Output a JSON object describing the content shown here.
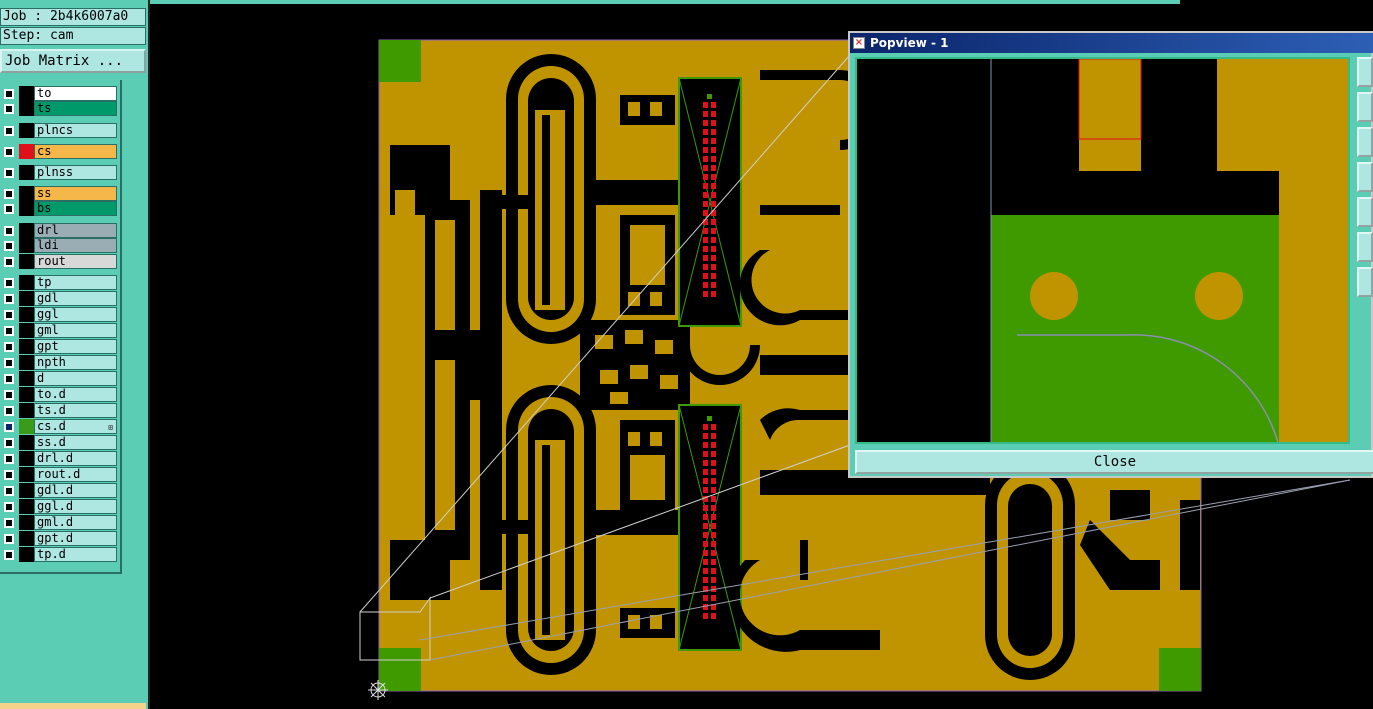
{
  "info": {
    "job": "Job : 2b4k6007a0",
    "step": "Step: cam",
    "job_matrix_label": "Job Matrix ..."
  },
  "layers": [
    {
      "name": "to",
      "bg": "#ffffff",
      "color": "#000000"
    },
    {
      "name": "ts",
      "bg": "#009a6a",
      "color": "#000000"
    },
    {
      "name": "plncs",
      "bg": "#aee6e2",
      "color": "#000000"
    },
    {
      "name": "cs",
      "bg": "#f5b64a",
      "color": "#e0101a"
    },
    {
      "name": "plnss",
      "bg": "#aee6e2",
      "color": "#000000"
    },
    {
      "name": "ss",
      "bg": "#f5b64a",
      "color": "#000000"
    },
    {
      "name": "bs",
      "bg": "#009a6a",
      "color": "#000000"
    },
    {
      "name": "drl",
      "bg": "#9aacb4",
      "color": "#000000"
    },
    {
      "name": "ldi",
      "bg": "#9aacb4",
      "color": "#000000"
    },
    {
      "name": "rout",
      "bg": "#d8d8d8",
      "color": "#000000"
    },
    {
      "name": "tp",
      "bg": "#aee6e2",
      "color": "#000000"
    },
    {
      "name": "gdl",
      "bg": "#aee6e2",
      "color": "#000000"
    },
    {
      "name": "ggl",
      "bg": "#aee6e2",
      "color": "#000000"
    },
    {
      "name": "gml",
      "bg": "#aee6e2",
      "color": "#000000"
    },
    {
      "name": "gpt",
      "bg": "#aee6e2",
      "color": "#000000"
    },
    {
      "name": "npth",
      "bg": "#aee6e2",
      "color": "#000000"
    },
    {
      "name": "d",
      "bg": "#aee6e2",
      "color": "#000000"
    },
    {
      "name": "to.d",
      "bg": "#aee6e2",
      "color": "#000000"
    },
    {
      "name": "ts.d",
      "bg": "#aee6e2",
      "color": "#000000"
    },
    {
      "name": "cs.d",
      "bg": "#aee6e2",
      "color": "#3a9a1a",
      "active": true
    },
    {
      "name": "ss.d",
      "bg": "#aee6e2",
      "color": "#000000"
    },
    {
      "name": "drl.d",
      "bg": "#aee6e2",
      "color": "#000000"
    },
    {
      "name": "rout.d",
      "bg": "#aee6e2",
      "color": "#000000"
    },
    {
      "name": "gdl.d",
      "bg": "#aee6e2",
      "color": "#000000"
    },
    {
      "name": "ggl.d",
      "bg": "#aee6e2",
      "color": "#000000"
    },
    {
      "name": "gml.d",
      "bg": "#aee6e2",
      "color": "#000000"
    },
    {
      "name": "gpt.d",
      "bg": "#aee6e2",
      "color": "#000000"
    },
    {
      "name": "tp.d",
      "bg": "#aee6e2",
      "color": "#000000"
    }
  ],
  "popview": {
    "title": "Popview - 1",
    "close_label": "Close"
  },
  "colors": {
    "copper": "#c09400",
    "soldermask": "#3f9a00",
    "pad": "#e0101a",
    "panel": "#5ccdb5"
  }
}
